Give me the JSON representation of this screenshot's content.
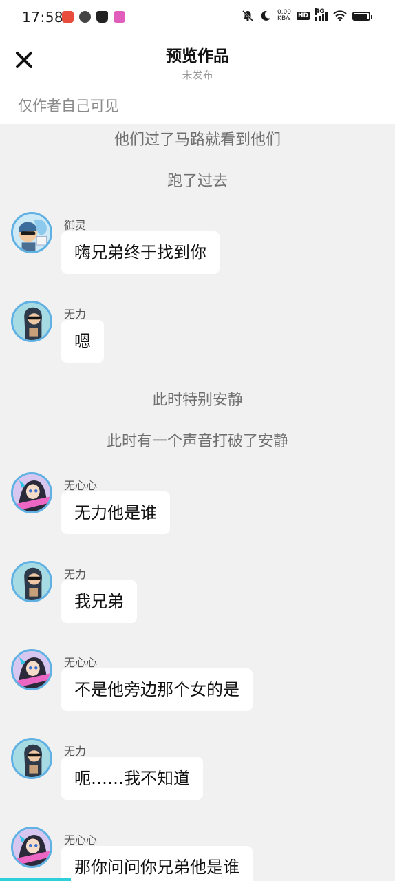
{
  "status_bar": {
    "time": "17:58",
    "netspeed_value": "0.00",
    "netspeed_unit": "KB/s",
    "hd_label": "HD",
    "network_label": "4G",
    "app_icons": [
      "red-app-icon",
      "help-app-icon",
      "tshirt-app-icon",
      "pink-app-icon"
    ],
    "status_icons": [
      "mute-icon",
      "moon-icon",
      "wifi-icon",
      "battery-icon"
    ]
  },
  "header": {
    "title": "预览作品",
    "subtitle": "未发布",
    "visibility_note": "仅作者自己可见",
    "close_icon": "close-icon"
  },
  "chat": {
    "items": [
      {
        "kind": "narration",
        "text": "他们过了马路就看到他们"
      },
      {
        "kind": "narration",
        "text": "跑了过去"
      },
      {
        "kind": "message",
        "sender": "御灵",
        "text": "嗨兄弟终于找到你",
        "avatar": "yuling-avatar"
      },
      {
        "kind": "message",
        "sender": "无力",
        "text": "嗯",
        "avatar": "wuli-avatar"
      },
      {
        "kind": "narration",
        "text": "此时特别安静"
      },
      {
        "kind": "narration",
        "text": "此时有一个声音打破了安静"
      },
      {
        "kind": "message",
        "sender": "无心心",
        "text": "无力他是谁",
        "avatar": "wuxinxin-avatar"
      },
      {
        "kind": "message",
        "sender": "无力",
        "text": "我兄弟",
        "avatar": "wuli-avatar"
      },
      {
        "kind": "message",
        "sender": "无心心",
        "text": "不是他旁边那个女的是",
        "avatar": "wuxinxin-avatar"
      },
      {
        "kind": "message",
        "sender": "无力",
        "text": "呃……我不知道",
        "avatar": "wuli-avatar"
      },
      {
        "kind": "message",
        "sender": "无心心",
        "text": "那你问问你兄弟他是谁",
        "avatar": "wuxinxin-avatar"
      }
    ]
  },
  "playback": {
    "progress_fraction": 0.18
  },
  "colors": {
    "accent": "#2fd0d9",
    "avatar_ring": "#5fb0e3",
    "chat_background": "#f1f1f1"
  }
}
